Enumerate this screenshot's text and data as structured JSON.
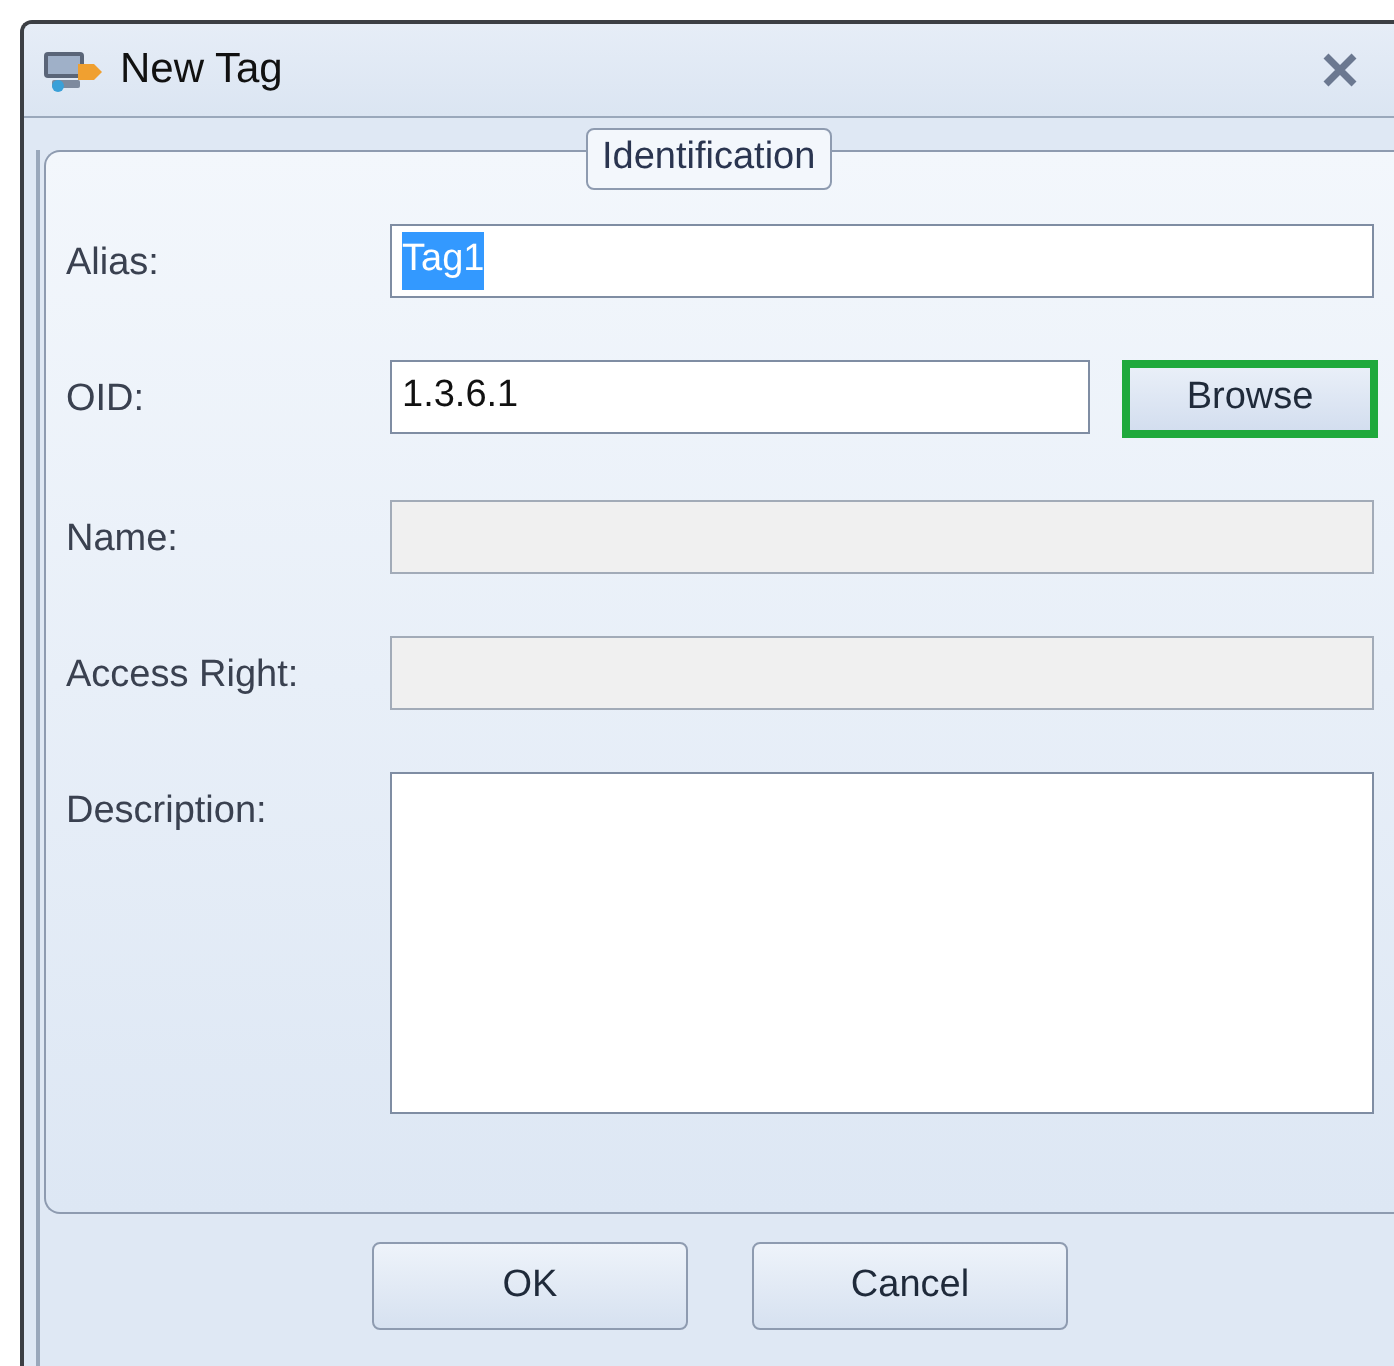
{
  "window": {
    "title": "New Tag"
  },
  "group": {
    "title": "Identification"
  },
  "fields": [
    {
      "kind": "text",
      "label": "Alias:",
      "value": "Tag1",
      "disabled": false,
      "text_selected": true
    },
    {
      "kind": "text",
      "label": "OID:",
      "value": "1.3.6.1",
      "disabled": false,
      "button": {
        "label": "Browse",
        "focused": true
      }
    },
    {
      "kind": "text",
      "label": "Name:",
      "disabled": true
    },
    {
      "kind": "text",
      "label": "Access Right:",
      "disabled": true
    },
    {
      "kind": "textarea",
      "label": "Description:",
      "disabled": false
    }
  ],
  "buttons": [
    {
      "label": "OK"
    },
    {
      "label": "Cancel"
    }
  ]
}
